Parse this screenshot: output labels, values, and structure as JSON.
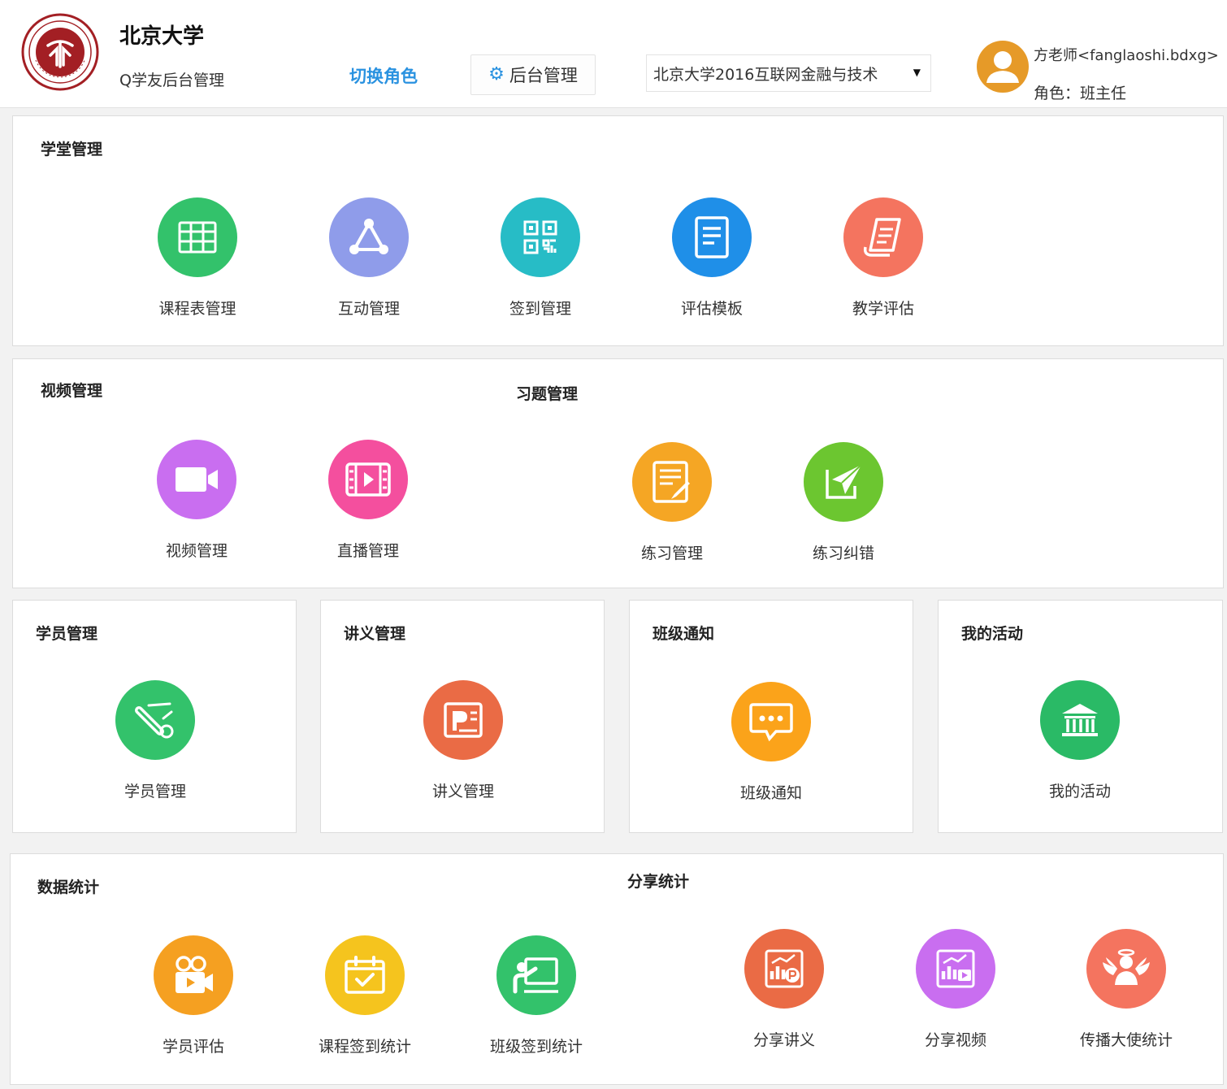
{
  "header": {
    "university_name": "北京大学",
    "subtitle": "Q学友后台管理",
    "switch_role_label": "切换角色",
    "admin_button_label": "后台管理",
    "class_selector_value": "北京大学2016互联网金融与技术",
    "user_name": "方老师<fanglaoshi.bdxg>",
    "user_role": "角色：班主任"
  },
  "sections": {
    "classroom": {
      "title": "学堂管理",
      "items": [
        {
          "label": "课程表管理",
          "icon": "table-grid-icon",
          "color": "#33c26b"
        },
        {
          "label": "互动管理",
          "icon": "triangle-network-icon",
          "color": "#8f9cea"
        },
        {
          "label": "签到管理",
          "icon": "qr-code-icon",
          "color": "#27bcc6"
        },
        {
          "label": "评估模板",
          "icon": "document-icon",
          "color": "#1f8fe8"
        },
        {
          "label": "教学评估",
          "icon": "scroll-icon",
          "color": "#f4745f"
        }
      ]
    },
    "video": {
      "title": "视频管理",
      "items": [
        {
          "label": "视频管理",
          "icon": "video-camera-icon",
          "color": "#c96ef0"
        },
        {
          "label": "直播管理",
          "icon": "film-play-icon",
          "color": "#f44f9e"
        }
      ]
    },
    "exercise": {
      "title": "习题管理",
      "items": [
        {
          "label": "练习管理",
          "icon": "edit-note-icon",
          "color": "#f5a624"
        },
        {
          "label": "练习纠错",
          "icon": "paper-plane-icon",
          "color": "#6cc630"
        }
      ]
    },
    "students": {
      "title": "学员管理",
      "items": [
        {
          "label": "学员管理",
          "icon": "diploma-icon",
          "color": "#33c26b"
        }
      ]
    },
    "handouts": {
      "title": "讲义管理",
      "items": [
        {
          "label": "讲义管理",
          "icon": "presentation-icon",
          "color": "#ea6b45"
        }
      ]
    },
    "notice": {
      "title": "班级通知",
      "items": [
        {
          "label": "班级通知",
          "icon": "chat-bubble-icon",
          "color": "#fba31a"
        }
      ]
    },
    "activity": {
      "title": "我的活动",
      "items": [
        {
          "label": "我的活动",
          "icon": "institution-icon",
          "color": "#2aba66"
        }
      ]
    },
    "stats": {
      "title": "数据统计",
      "items": [
        {
          "label": "学员评估",
          "icon": "movie-camera-icon",
          "color": "#f5a021"
        },
        {
          "label": "课程签到统计",
          "icon": "calendar-check-icon",
          "color": "#f5c41e"
        },
        {
          "label": "班级签到统计",
          "icon": "teacher-board-icon",
          "color": "#33c26b"
        }
      ]
    },
    "share": {
      "title": "分享统计",
      "items": [
        {
          "label": "分享讲义",
          "icon": "chart-p-icon",
          "color": "#ea6b45"
        },
        {
          "label": "分享视频",
          "icon": "chart-video-icon",
          "color": "#c96ef0"
        },
        {
          "label": "传播大使统计",
          "icon": "angel-person-icon",
          "color": "#f4745f"
        }
      ]
    }
  }
}
